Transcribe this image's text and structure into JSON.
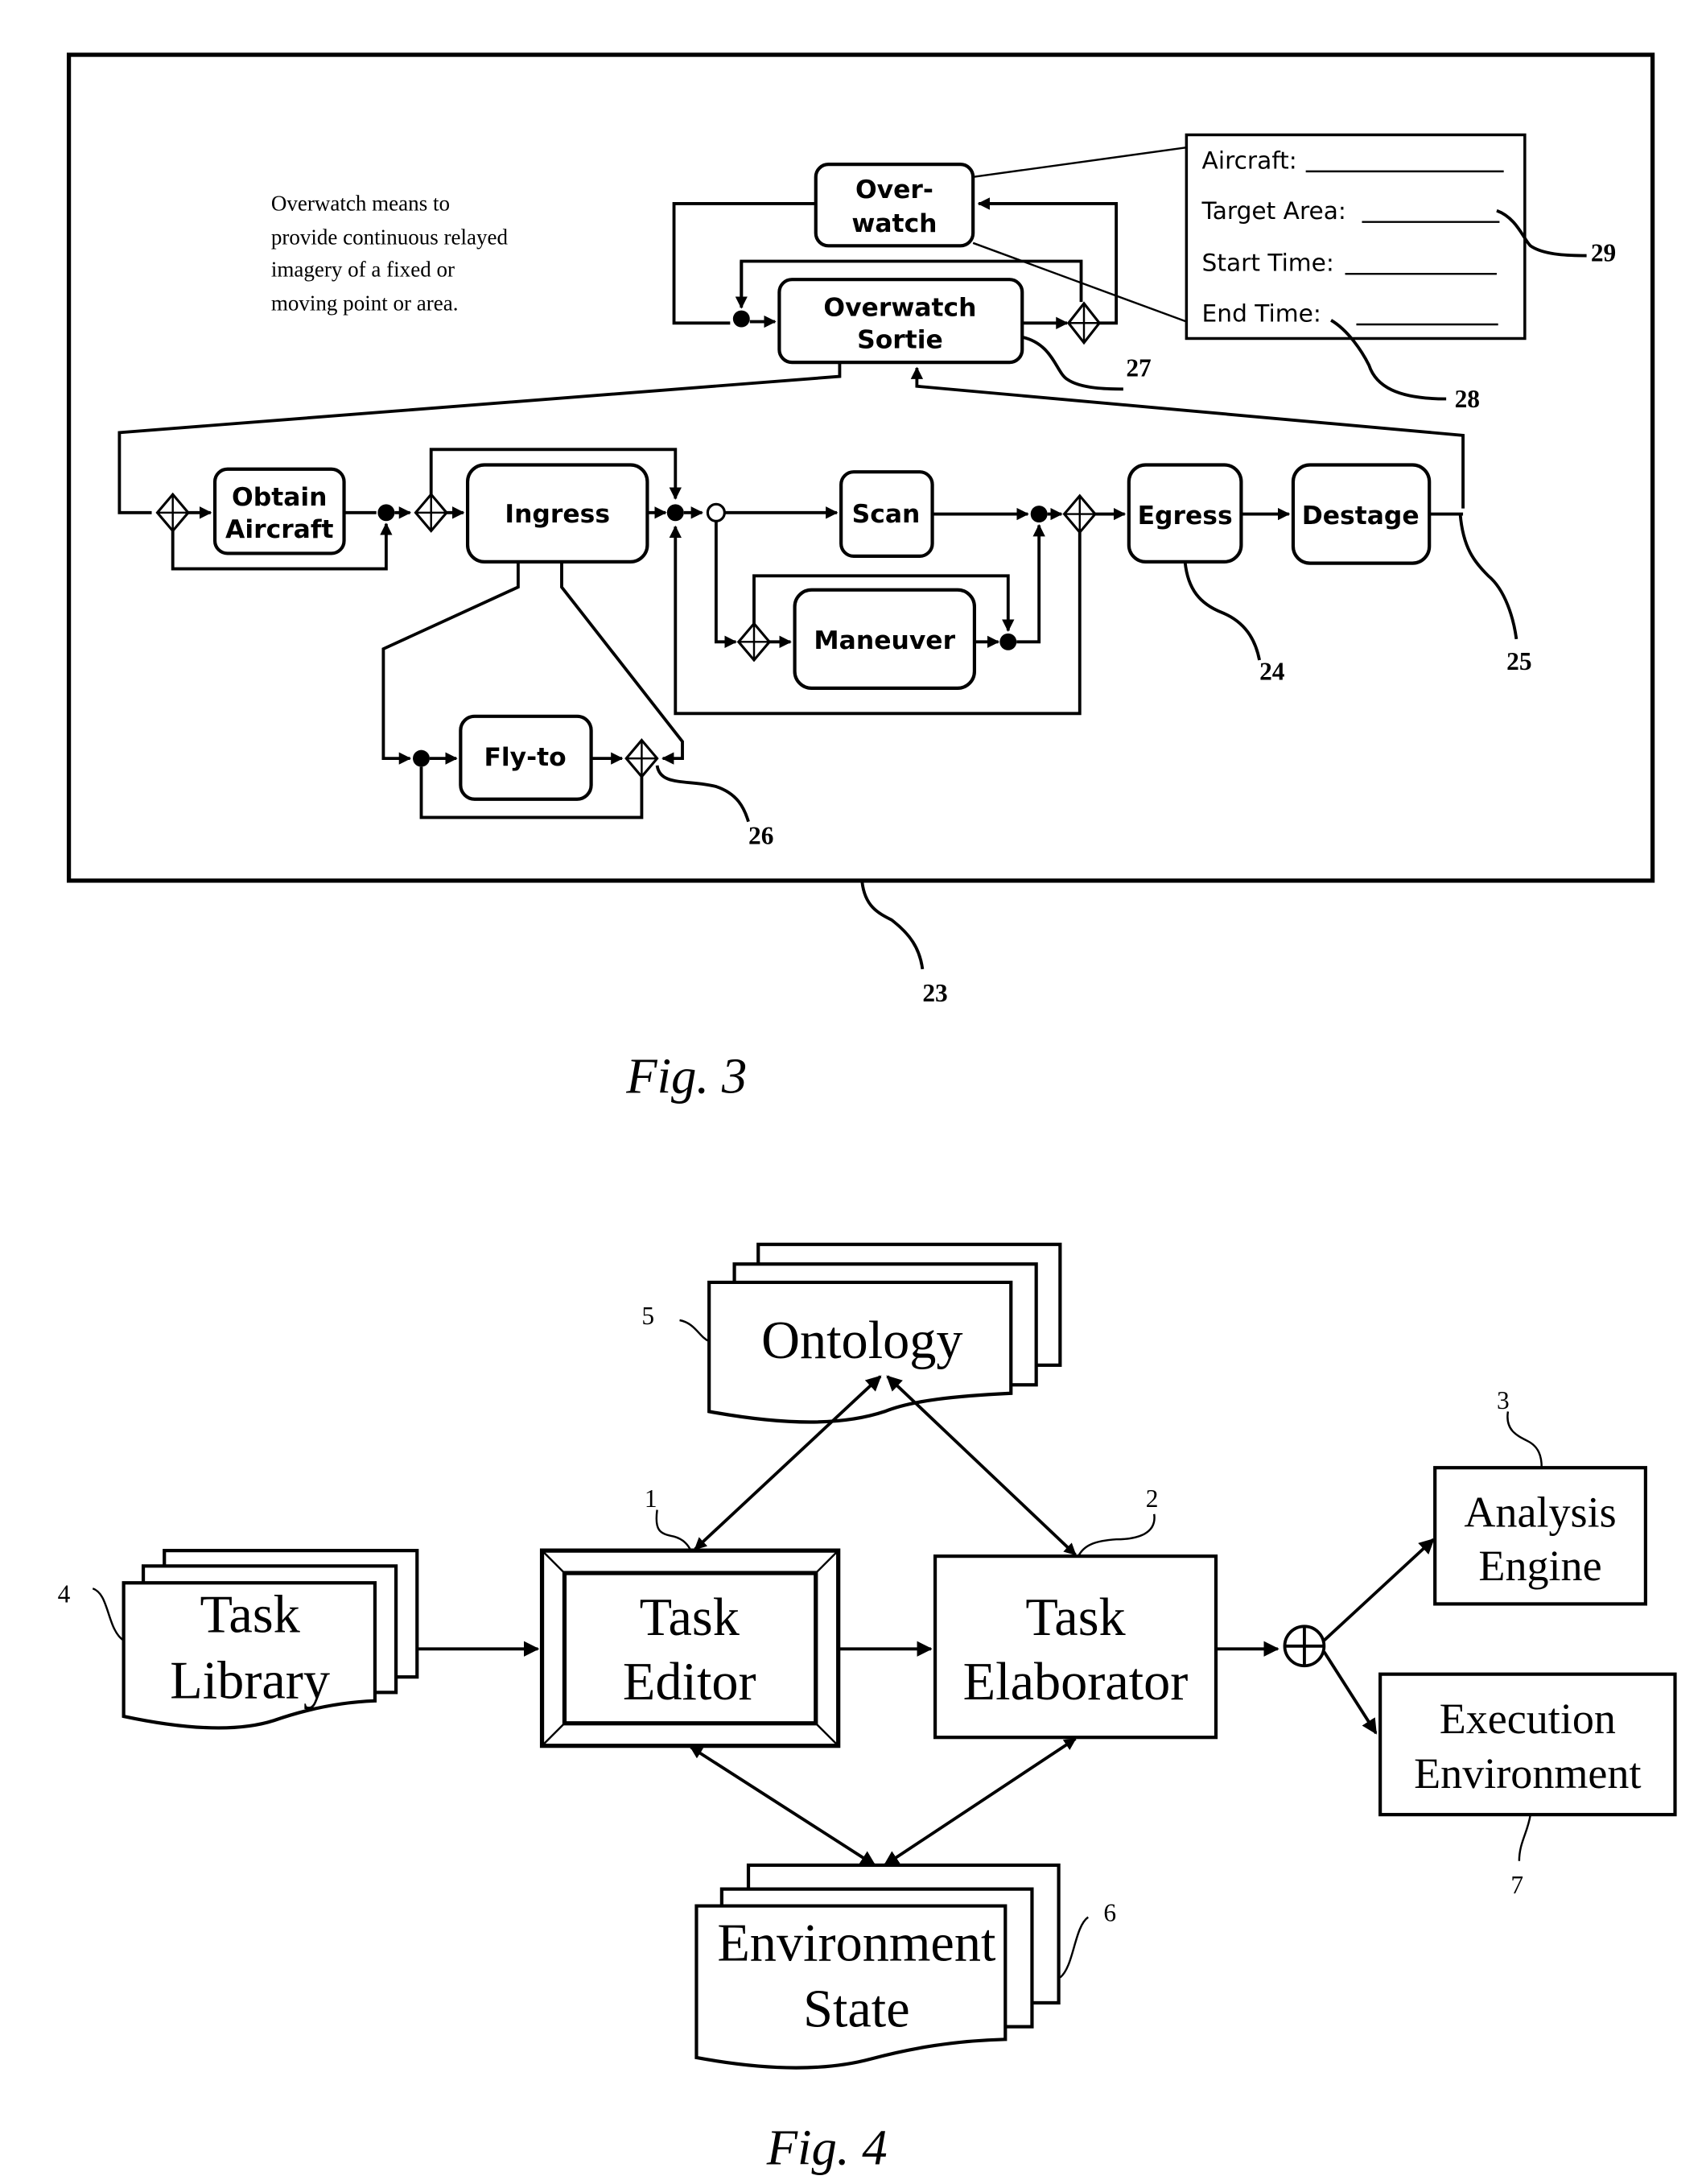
{
  "figure3": {
    "caption": "Fig. 3",
    "note_lines": [
      "Overwatch means to",
      "provide continuous relayed",
      "imagery of a fixed or",
      "moving point or area."
    ],
    "tasks": {
      "overwatch": [
        "Over-",
        "watch"
      ],
      "overwatch_sortie": [
        "Overwatch",
        "Sortie"
      ],
      "obtain_aircraft": [
        "Obtain",
        "Aircraft"
      ],
      "ingress": "Ingress",
      "scan": "Scan",
      "maneuver": "Maneuver",
      "egress": "Egress",
      "destage": "Destage",
      "fly_to": "Fly-to"
    },
    "parameter_form": {
      "fields": [
        "Aircraft:",
        "Target Area:",
        "Start Time:",
        "End Time:"
      ]
    },
    "reference_numerals": {
      "frame": "23",
      "egress": "24",
      "destage": "25",
      "fly_to_gate": "26",
      "sortie": "27",
      "end_time": "28",
      "target_area": "29"
    }
  },
  "figure4": {
    "caption": "Fig. 4",
    "components": {
      "task_library": [
        "Task",
        "Library"
      ],
      "ontology": "Ontology",
      "task_editor": [
        "Task",
        "Editor"
      ],
      "task_elaborator": [
        "Task",
        "Elaborator"
      ],
      "environment_state": [
        "Environment",
        "State"
      ],
      "analysis_engine": [
        "Analysis",
        "Engine"
      ],
      "execution_environment": [
        "Execution",
        "Environment"
      ]
    },
    "reference_numerals": {
      "task_editor": "1",
      "task_elaborator": "2",
      "analysis_engine": "3",
      "task_library": "4",
      "ontology": "5",
      "environment_state": "6",
      "execution_environment": "7"
    }
  }
}
